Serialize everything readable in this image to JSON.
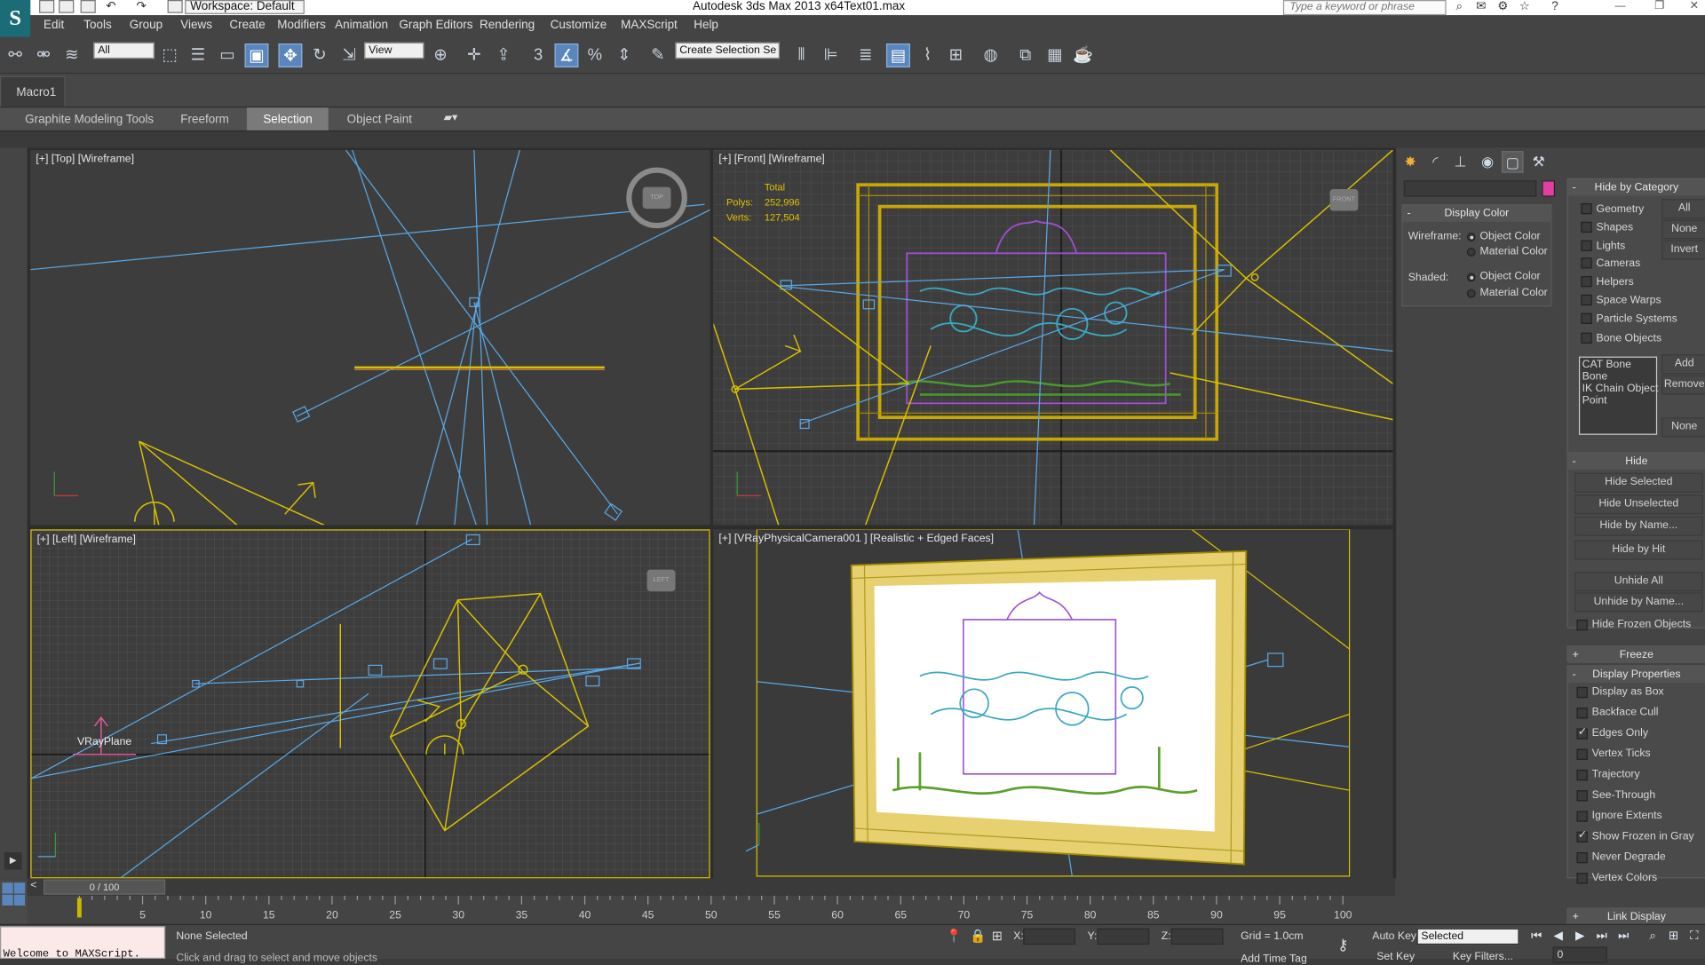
{
  "app": {
    "title": "Autodesk 3ds Max  2013 x64",
    "file": "Text01.max",
    "logo": "S",
    "workspace": "Workspace: Default",
    "search_placeholder": "Type a keyword or phrase"
  },
  "menu": [
    "Edit",
    "Tools",
    "Group",
    "Views",
    "Create",
    "Modifiers",
    "Animation",
    "Graph Editors",
    "Rendering",
    "Customize",
    "MAXScript",
    "Help"
  ],
  "toolbar": {
    "selection_filter": "All",
    "ref_coord": "View",
    "named_selection": "Create Selection Se",
    "snaps": {
      "snap3": "3",
      "angle": "%",
      "spinner": "%"
    }
  },
  "macro_tab": "Macro1",
  "ribbon_tabs": [
    "Graphite Modeling Tools",
    "Freeform",
    "Selection",
    "Object Paint"
  ],
  "ribbon_active": "Selection",
  "viewports": {
    "top": {
      "label": "[+] [Top] [Wireframe]",
      "cube": "TOP"
    },
    "front": {
      "label": "[+] [Front] [Wireframe]",
      "cube": "FRONT",
      "stats_title": "Total",
      "polys_label": "Polys:",
      "polys": "252,996",
      "verts_label": "Verts:",
      "verts": "127,504"
    },
    "left": {
      "label": "[+] [Left] [Wireframe]",
      "cube": "LEFT",
      "object_label": "VRayPlane"
    },
    "camera": {
      "label": "[+] [VRayPhysicalCamera001 ] [Realistic + Edged Faces]"
    }
  },
  "command_panel": {
    "display_color": {
      "title": "Display Color",
      "wireframe_label": "Wireframe:",
      "shaded_label": "Shaded:",
      "option_object": "Object Color",
      "option_material": "Material Color"
    },
    "hide_by_category": {
      "title": "Hide by Category",
      "items": [
        "Geometry",
        "Shapes",
        "Lights",
        "Cameras",
        "Helpers",
        "Space Warps",
        "Particle Systems",
        "Bone Objects"
      ],
      "buttons": [
        "All",
        "None",
        "Invert"
      ],
      "list": [
        "CAT Bone",
        "Bone",
        "IK Chain Object",
        "Point"
      ],
      "list_buttons": [
        "Add",
        "Remove",
        "None"
      ]
    },
    "hide": {
      "title": "Hide",
      "buttons": [
        "Hide Selected",
        "Hide Unselected",
        "Hide by Name...",
        "Hide by Hit",
        "Unhide All",
        "Unhide by Name..."
      ],
      "frozen": "Hide Frozen Objects"
    },
    "freeze": {
      "title": "Freeze"
    },
    "display_properties": {
      "title": "Display Properties",
      "items": [
        {
          "label": "Display as Box",
          "checked": false
        },
        {
          "label": "Backface Cull",
          "checked": false
        },
        {
          "label": "Edges Only",
          "checked": true
        },
        {
          "label": "Vertex Ticks",
          "checked": false
        },
        {
          "label": "Trajectory",
          "checked": false
        },
        {
          "label": "See-Through",
          "checked": false
        },
        {
          "label": "Ignore Extents",
          "checked": false
        },
        {
          "label": "Show Frozen in Gray",
          "checked": true
        },
        {
          "label": "Never Degrade",
          "checked": false
        },
        {
          "label": "Vertex Colors",
          "checked": false
        }
      ]
    },
    "link_display": {
      "title": "Link Display"
    }
  },
  "timeline": {
    "slider": "0 / 100",
    "ticks": [
      "5",
      "10",
      "15",
      "20",
      "25",
      "30",
      "35",
      "40",
      "45",
      "50",
      "55",
      "60",
      "65",
      "70",
      "75",
      "80",
      "85",
      "90",
      "95",
      "100"
    ]
  },
  "status": {
    "maxscript": "Welcome to MAXScript.",
    "selection": "None Selected",
    "prompt": "Click and drag to select and move objects",
    "x_label": "X:",
    "y_label": "Y:",
    "z_label": "Z:",
    "grid": "Grid = 1.0cm",
    "auto_key": "Auto Key",
    "set_key": "Set Key",
    "key_mode": "Selected",
    "key_filters": "Key Filters...",
    "add_time_tag": "Add Time Tag",
    "frame": "0"
  },
  "colors": {
    "viewport_bg": "#3d3d3d",
    "grid": "#555555",
    "selection_yellow": "#d9c100",
    "gizmo_blue": "#5aa8e6",
    "active_button": "#5a86bd"
  }
}
